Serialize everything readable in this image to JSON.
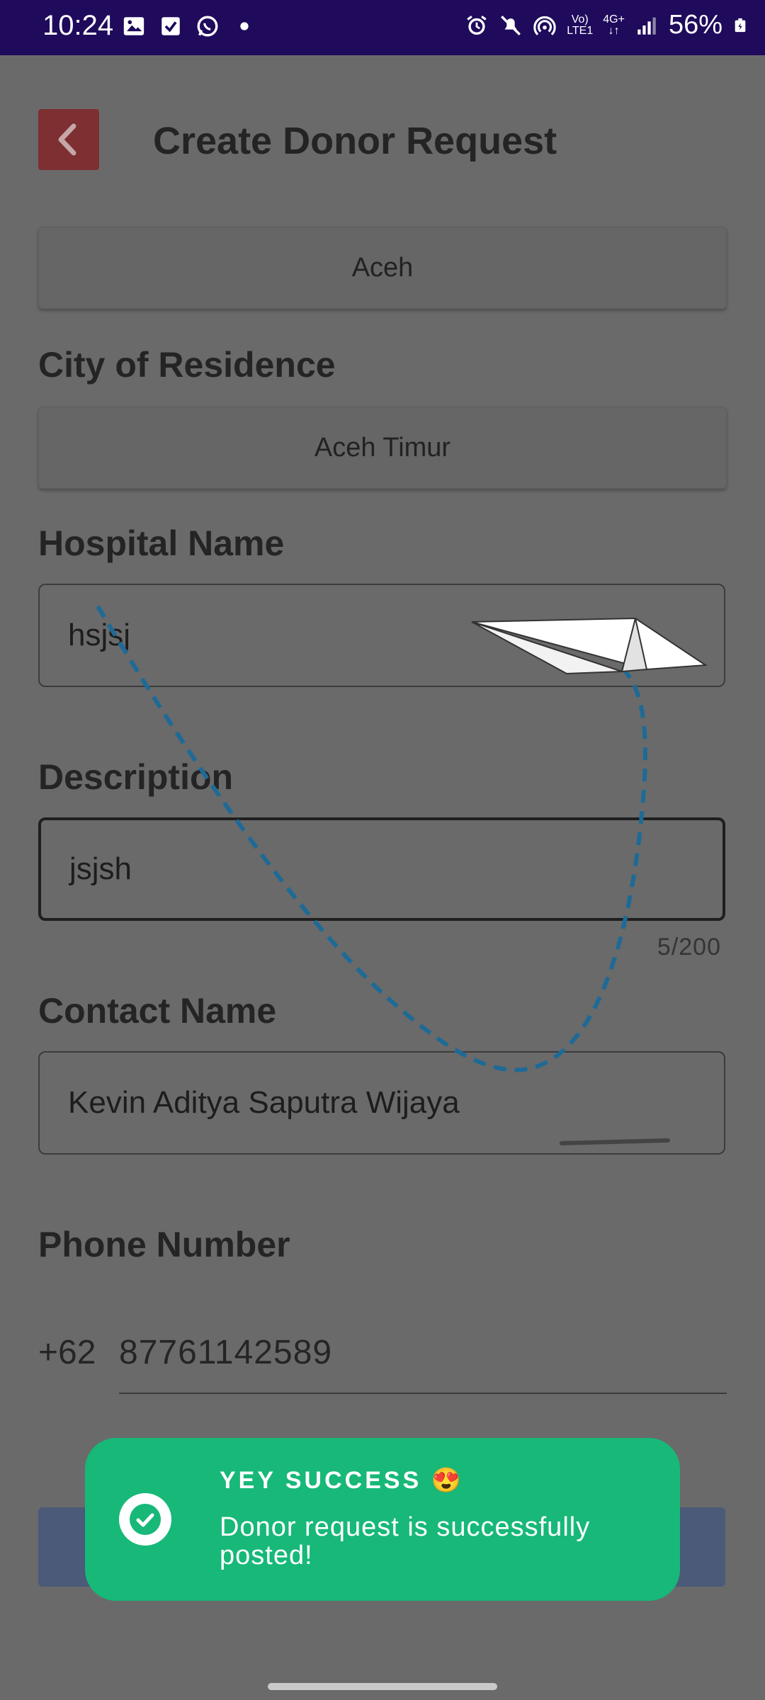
{
  "status_bar": {
    "time": "10:24",
    "network_top": "Vo)",
    "network_bottom": "LTE1",
    "data_top": "4G+",
    "battery": "56%",
    "icons": [
      "gallery-icon",
      "checkbox-icon",
      "whatsapp-icon",
      "dot-icon",
      "alarm-icon",
      "mute-icon",
      "hotspot-icon",
      "signal-icon",
      "battery-icon"
    ]
  },
  "header": {
    "title": "Create Donor Request",
    "back_icon": "chevron-left-icon"
  },
  "form": {
    "province_value": "Aceh",
    "city_label": "City of Residence",
    "city_value": "Aceh Timur",
    "hospital_label": "Hospital Name",
    "hospital_value": "hsjsj",
    "description_label": "Description",
    "description_value": "jsjsh",
    "description_counter": "5/200",
    "contact_label": "Contact Name",
    "contact_value": "Kevin Aditya Saputra Wijaya",
    "phone_label": "Phone Number",
    "phone_prefix": "+62",
    "phone_value": "87761142589"
  },
  "toast": {
    "title": "YEY SUCCESS 😍",
    "message": "Donor request is successfully posted!",
    "icon": "check-circle-icon",
    "color": "#17b878"
  },
  "colors": {
    "status_bar": "#1f0a5c",
    "back_button": "#7d2f32",
    "submit_button": "#4a5a78",
    "scrim": "#6a6a6a"
  }
}
